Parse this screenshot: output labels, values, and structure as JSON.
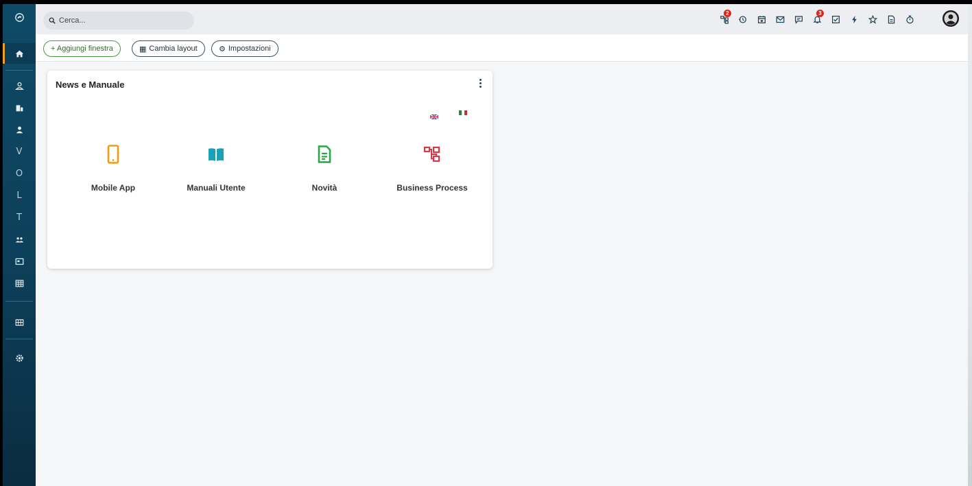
{
  "search": {
    "placeholder": "Cerca..."
  },
  "topbar": {
    "badges": {
      "workflow": "2",
      "notifications": "3"
    }
  },
  "toolbar": {
    "add_window": "+ Aggiungi finestra",
    "change_layout": "Cambia layout",
    "settings": "Impostazioni"
  },
  "sidebar": {
    "letters": [
      "V",
      "O",
      "L",
      "T"
    ]
  },
  "card": {
    "title": "News e Manuale",
    "tiles": [
      {
        "label": "Mobile App",
        "icon": "mobile-phone-icon",
        "color": "#f39c12"
      },
      {
        "label": "Manuali Utente",
        "icon": "open-book-icon",
        "color": "#17a2b8"
      },
      {
        "label": "Novità",
        "icon": "document-icon",
        "color": "#28a745"
      },
      {
        "label": "Business Process",
        "icon": "process-tree-icon",
        "color": "#dc3545"
      }
    ]
  },
  "colors": {
    "sidebar": "#0e4a66",
    "accent_active": "#f0a020",
    "badge": "#d9261c"
  }
}
